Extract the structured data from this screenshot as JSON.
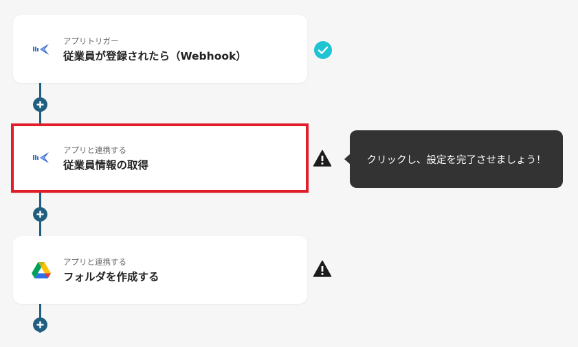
{
  "steps": [
    {
      "subtitle": "アプリトリガー",
      "title": "従業員が登録されたら（Webhook）",
      "app_icon": "employee-app-icon",
      "status": "check-icon"
    },
    {
      "subtitle": "アプリと連携する",
      "title": "従業員情報の取得",
      "app_icon": "employee-app-icon",
      "status": "warning-icon"
    },
    {
      "subtitle": "アプリと連携する",
      "title": "フォルダを作成する",
      "app_icon": "google-drive-icon",
      "status": "warning-icon"
    }
  ],
  "tooltip": {
    "text": "クリックし、設定を完了させましょう！"
  },
  "colors": {
    "connector": "#1f5e7e",
    "check": "#1fc4d4",
    "highlight_border": "#e11d2a",
    "tooltip_bg": "#333333"
  }
}
